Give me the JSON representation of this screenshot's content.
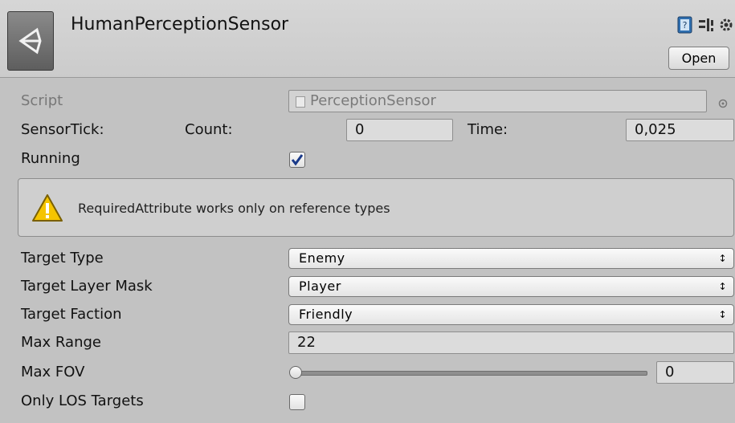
{
  "header": {
    "title": "HumanPerceptionSensor",
    "open_label": "Open",
    "icons": [
      "help-book-icon",
      "preset-icon",
      "gear-icon"
    ]
  },
  "script": {
    "label": "Script",
    "value": "PerceptionSensor"
  },
  "sensor_tick": {
    "label": "SensorTick:",
    "count_label": "Count:",
    "count_value": "0",
    "time_label": "Time:",
    "time_value": "0,025"
  },
  "running": {
    "label": "Running",
    "checked": true
  },
  "helpbox": {
    "message": "RequiredAttribute works only on reference types"
  },
  "target_type": {
    "label": "Target Type",
    "value": "Enemy"
  },
  "target_layer_mask": {
    "label": "Target Layer Mask",
    "value": "Player"
  },
  "target_faction": {
    "label": "Target Faction",
    "value": "Friendly"
  },
  "max_range": {
    "label": "Max Range",
    "value": "22"
  },
  "max_fov": {
    "label": "Max FOV",
    "value": "0"
  },
  "only_los": {
    "label": "Only LOS Targets",
    "checked": false
  },
  "colors": {
    "background": "#c2c2c2",
    "check": "#1a3a8a",
    "warning": "#f5c400"
  }
}
